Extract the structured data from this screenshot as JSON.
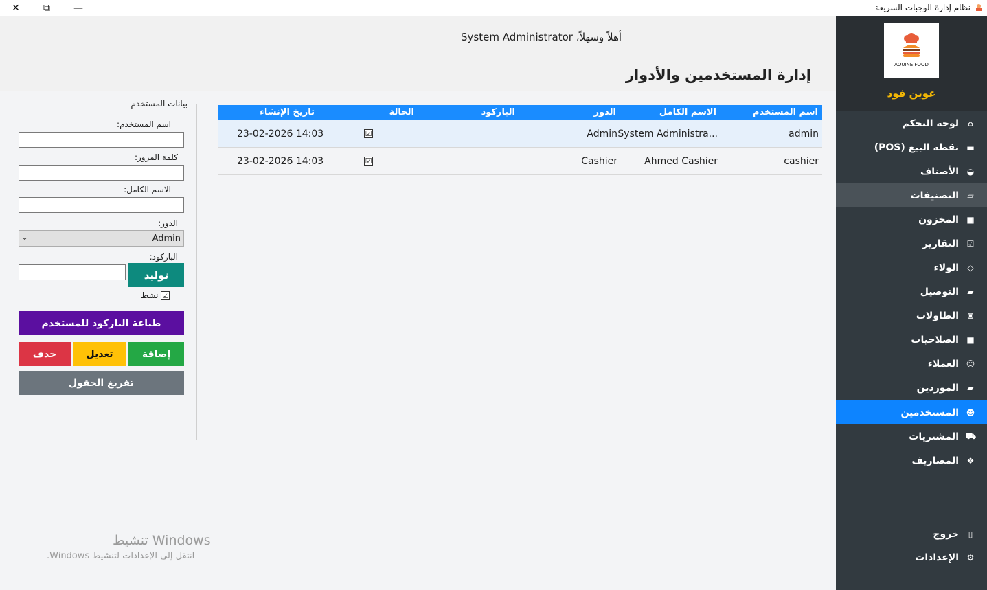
{
  "window": {
    "title": "نظام إدارة الوجبات السريعة"
  },
  "header": {
    "welcome": "أهلاً وسهلاً، System Administrator",
    "page_title": "إدارة المستخدمين والأدوار"
  },
  "form": {
    "group_title": "بيانات المستخدم",
    "username_label": "اسم المستخدم:",
    "password_label": "كلمة المرور:",
    "fullname_label": "الاسم الكامل:",
    "role_label": "الدور:",
    "role_value": "Admin",
    "barcode_label": "الباركود:",
    "generate_button": "توليد",
    "active_label": "نشط",
    "active_checked": "☑",
    "print_button": "طباعة الباركود للمستخدم",
    "add_button": "إضافة",
    "edit_button": "تعديل",
    "delete_button": "حذف",
    "clear_button": "تفريغ الحقول"
  },
  "grid": {
    "columns": [
      "اسم المستخدم",
      "الاسم الكامل",
      "الدور",
      "الباركود",
      "الحالة",
      "تاريخ الإنشاء"
    ],
    "rows": [
      {
        "username": "admin",
        "fullname": "System Administra...",
        "role": "Admin",
        "barcode": "",
        "status": "☑",
        "created": "23-02-2026 14:03"
      },
      {
        "username": "cashier",
        "fullname": "Ahmed Cashier",
        "role": "Cashier",
        "barcode": "",
        "status": "☑",
        "created": "23-02-2026 14:03"
      }
    ]
  },
  "watermark": {
    "line1": "تنشيط Windows",
    "line2": "انتقل إلى الإعدادات لتنشيط Windows."
  },
  "sidebar": {
    "logo_text": "AOUINE FOOD",
    "brand": "عوين فود",
    "items": [
      {
        "label": "لوحة التحكم",
        "icon": "home-icon"
      },
      {
        "label": "نقطة البيع (POS)",
        "icon": "register-icon"
      },
      {
        "label": "الأصناف",
        "icon": "dish-icon"
      },
      {
        "label": "التصنيفات",
        "icon": "folder-icon"
      },
      {
        "label": "المخزون",
        "icon": "inventory-icon"
      },
      {
        "label": "التقارير",
        "icon": "report-icon"
      },
      {
        "label": "الولاء",
        "icon": "diamond-icon"
      },
      {
        "label": "التوصيل",
        "icon": "truck-icon"
      },
      {
        "label": "الطاولات",
        "icon": "table-icon"
      },
      {
        "label": "الصلاحيات",
        "icon": "lock-icon"
      },
      {
        "label": "العملاء",
        "icon": "user-icon"
      },
      {
        "label": "الموردين",
        "icon": "supplier-truck-icon"
      },
      {
        "label": "المستخدمين",
        "icon": "users-icon"
      },
      {
        "label": "المشتريات",
        "icon": "cart-icon"
      },
      {
        "label": "المصاريف",
        "icon": "money-icon"
      }
    ],
    "logout": "خروج",
    "settings": "الإعدادات"
  }
}
